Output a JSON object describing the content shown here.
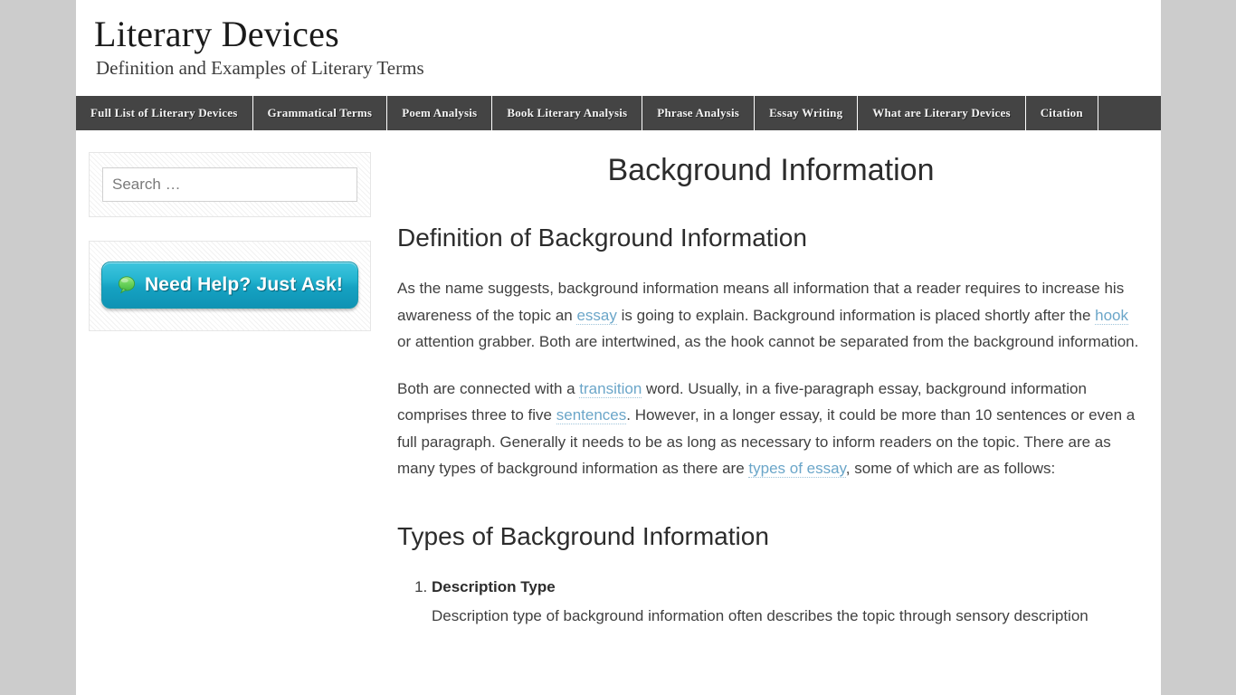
{
  "header": {
    "site_title": "Literary Devices",
    "site_description": "Definition and Examples of Literary Terms"
  },
  "nav": {
    "items": [
      {
        "label": "Full List of Literary Devices"
      },
      {
        "label": "Grammatical Terms"
      },
      {
        "label": "Poem Analysis"
      },
      {
        "label": "Book Literary Analysis"
      },
      {
        "label": "Phrase Analysis"
      },
      {
        "label": "Essay Writing"
      },
      {
        "label": "What are Literary Devices"
      },
      {
        "label": "Citation"
      }
    ]
  },
  "sidebar": {
    "search": {
      "placeholder": "Search …",
      "value": ""
    },
    "help_widget": {
      "button_label": "Need Help? Just Ask!",
      "icon": "speech-bubble-icon",
      "icon_color": "#66d35c",
      "button_color": "#1ba9c4"
    }
  },
  "main": {
    "page_title": "Background Information",
    "definition_heading": "Definition of Background Information",
    "paragraph_1": {
      "part_1": "As the name suggests, background information means all information that a reader requires to increase his awareness of the topic an ",
      "link_1": "essay",
      "part_2": " is going to explain. Background information is placed shortly after the ",
      "link_2": "hook",
      "part_3": " or attention grabber. Both are intertwined, as the hook cannot be separated from the background information."
    },
    "paragraph_2": {
      "part_1": "Both are connected with a ",
      "link_1": "transition",
      "part_2": " word. Usually, in a five-paragraph essay, background information comprises three to five ",
      "link_2": "sentences",
      "part_3": ". However, in a longer essay, it could be more than 10 sentences or even a full paragraph. Generally it needs to be as long as necessary to inform readers on the topic. There are as many types of background information as there are ",
      "link_3": "types of essay",
      "part_4": ", some of which are as follows:"
    },
    "types_heading": "Types of Background Information",
    "types": [
      {
        "title": "Description Type",
        "description": "Description type of background information often describes the topic through sensory description"
      }
    ]
  },
  "theme": {
    "page_background": "#cccccc",
    "content_background": "#ffffff",
    "nav_background": "#444444",
    "link_color": "#6ba6c9",
    "text_color": "#404040"
  }
}
